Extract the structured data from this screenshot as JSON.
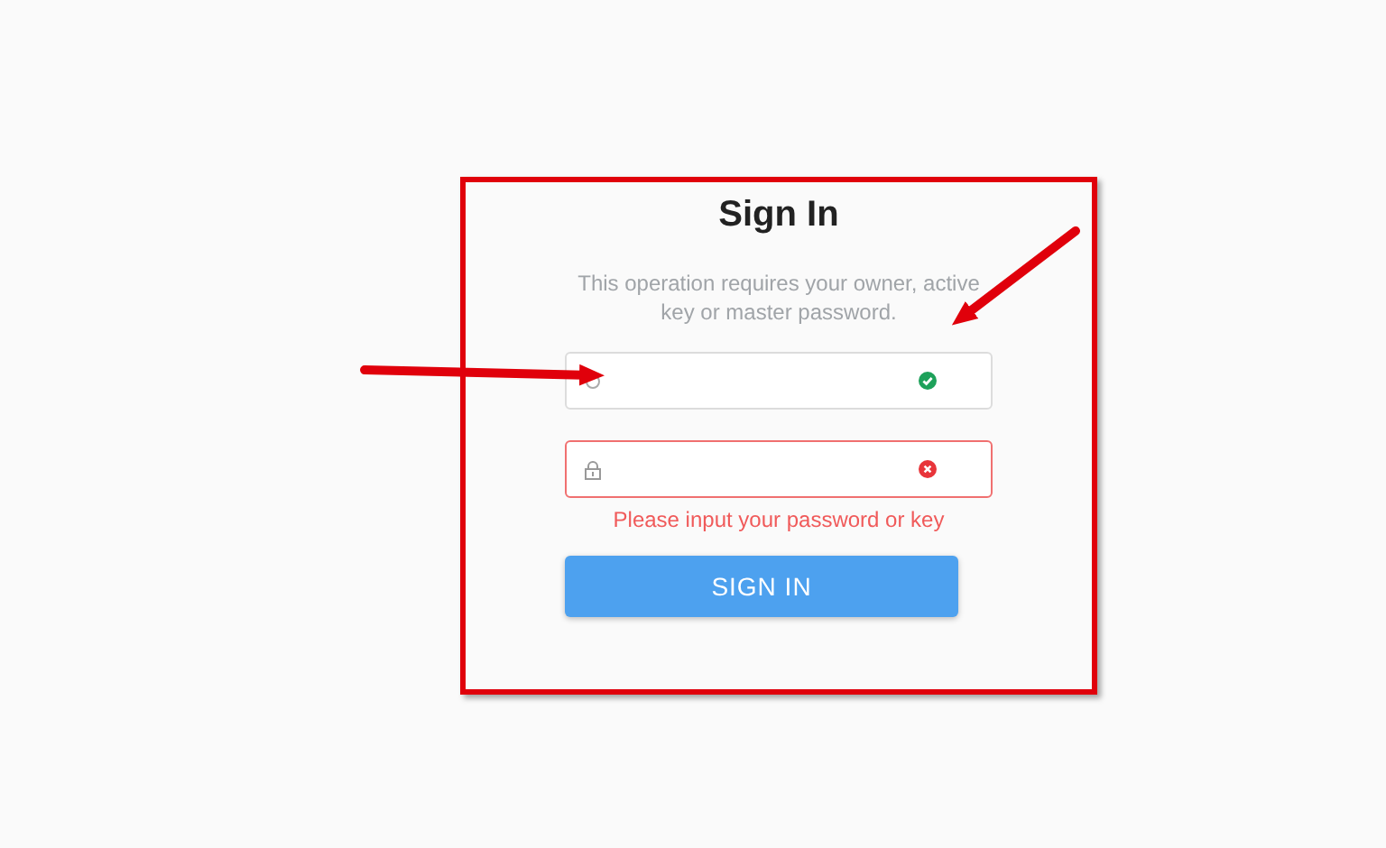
{
  "title": "Sign In",
  "subtitle": "This operation requires your owner, active key or master password.",
  "fields": [
    {
      "kind": "user",
      "valid": true
    },
    {
      "kind": "password",
      "valid": false,
      "error": "Please input your password or key"
    }
  ],
  "button": "SIGN IN"
}
